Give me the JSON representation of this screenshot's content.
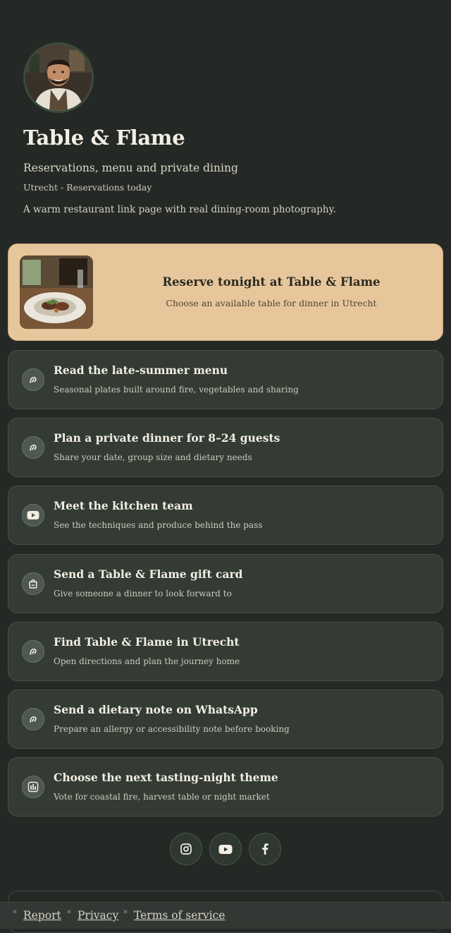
{
  "profile": {
    "name": "Table & Flame",
    "subtitle": "Reservations, menu and private dining",
    "meta": "Utrecht - Reservations today",
    "description": "A warm restaurant link page with real dining-room photography."
  },
  "featured": {
    "title": "Reserve tonight at Table & Flame",
    "subtitle": "Choose an available table for dinner in Utrecht"
  },
  "links": [
    {
      "title": "Read the late-summer menu",
      "subtitle": "Seasonal plates built around fire, vegetables and sharing",
      "icon": "link-icon"
    },
    {
      "title": "Plan a private dinner for 8–24 guests",
      "subtitle": "Share your date, group size and dietary needs",
      "icon": "link-icon"
    },
    {
      "title": "Meet the kitchen team",
      "subtitle": "See the techniques and produce behind the pass",
      "icon": "youtube-icon"
    },
    {
      "title": "Send a Table & Flame gift card",
      "subtitle": "Give someone a dinner to look forward to",
      "icon": "shopping-bag-icon"
    },
    {
      "title": "Find Table & Flame in Utrecht",
      "subtitle": "Open directions and plan the journey home",
      "icon": "link-icon"
    },
    {
      "title": "Send a dietary note on WhatsApp",
      "subtitle": "Prepare an allergy or accessibility note before booking",
      "icon": "link-icon"
    },
    {
      "title": "Choose the next tasting-night theme",
      "subtitle": "Vote for coastal fire, harvest table or night market",
      "icon": "poll-icon"
    }
  ],
  "social": [
    "instagram-icon",
    "youtube-icon",
    "facebook-icon"
  ],
  "footer": {
    "links": [
      "Report",
      "Privacy",
      "Terms of service"
    ],
    "separator": "*"
  }
}
